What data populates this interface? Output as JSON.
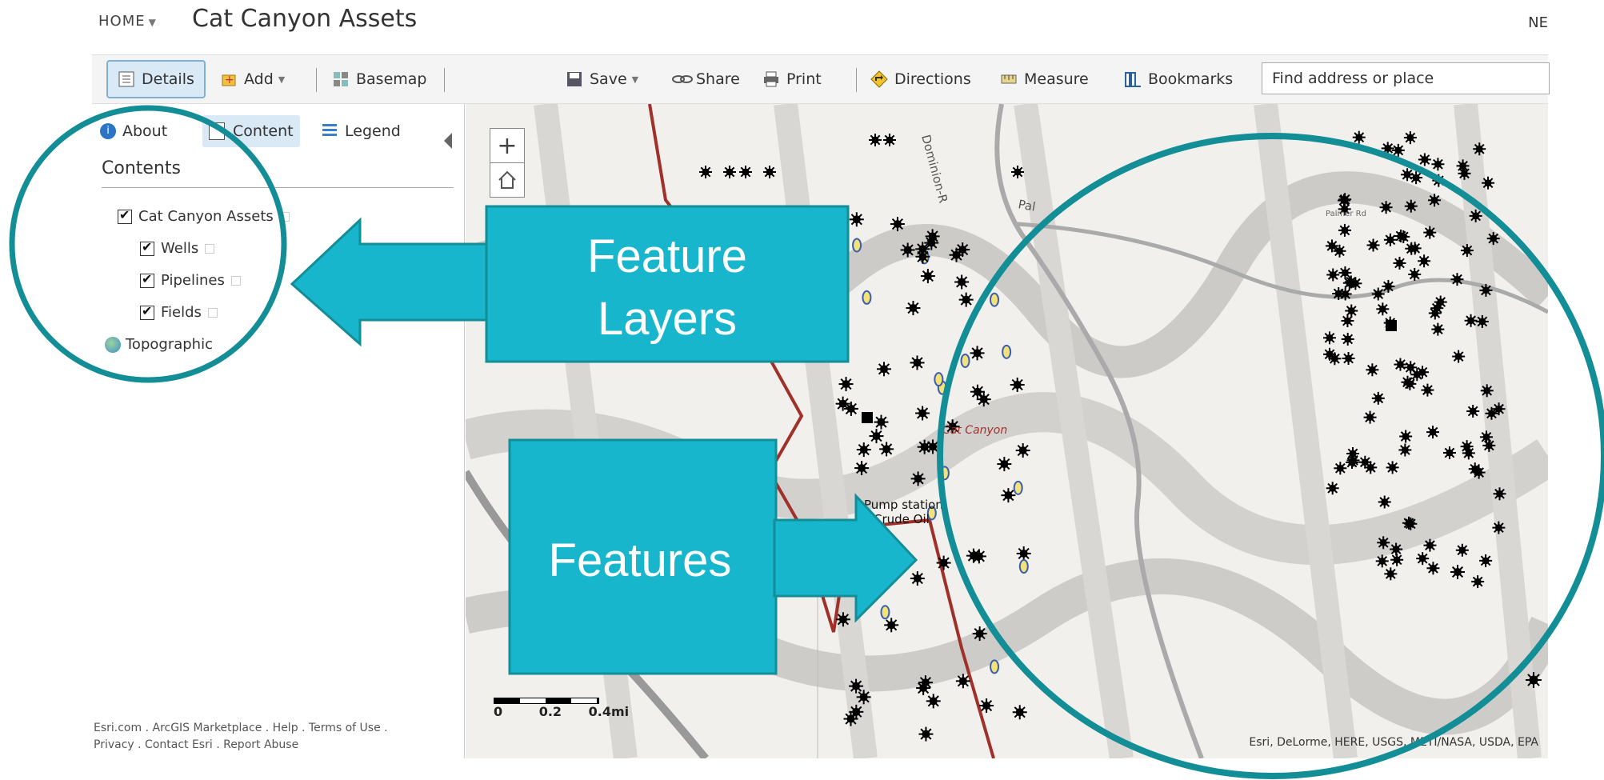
{
  "header": {
    "home": "HOME",
    "title": "Cat Canyon Assets",
    "right_text": "NE"
  },
  "toolbar": {
    "details": "Details",
    "add": "Add",
    "basemap": "Basemap",
    "save": "Save",
    "share": "Share",
    "print": "Print",
    "directions": "Directions",
    "measure": "Measure",
    "bookmarks": "Bookmarks",
    "search_placeholder": "Find address or place"
  },
  "panel": {
    "tabs": {
      "about": "About",
      "content": "Content",
      "legend": "Legend"
    },
    "heading": "Contents",
    "layers": {
      "group": "Cat Canyon Assets",
      "wells": "Wells",
      "pipelines": "Pipelines",
      "fields": "Fields",
      "basemap": "Topographic"
    },
    "footer_line1": "Esri.com . ArcGIS Marketplace . Help . Terms of Use .",
    "footer_line2": "Privacy . Contact Esri . Report Abuse"
  },
  "map": {
    "labels": {
      "dominion": "Dominion-R",
      "pal": "Pal",
      "palmer": "Palmer Rd",
      "cat_canyon": "Cat Canyon",
      "pump_station": "Pump station",
      "crude_oil": "Crude Oil"
    },
    "scale_ticks": [
      "0",
      "0.2",
      "0.4mi"
    ],
    "attribution": "Esri, DeLorme, HERE, USGS, METI/NASA, USDA, EPA",
    "zoom_in": "+"
  },
  "annotations": {
    "feature_layers_line1": "Feature",
    "feature_layers_line2": "Layers",
    "features": "Features",
    "callout_color": "#17b6cc",
    "circle_color": "#138d96"
  }
}
